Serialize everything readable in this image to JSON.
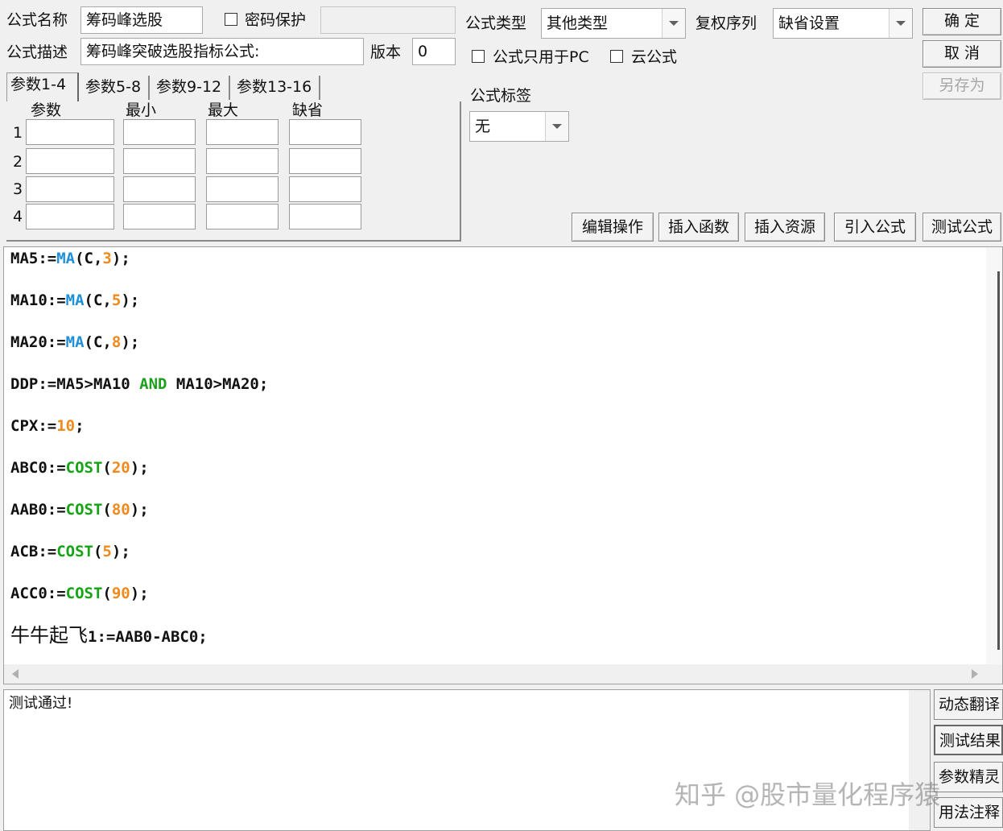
{
  "header": {
    "name_label": "公式名称",
    "name_value": "筹码峰选股",
    "password_label": "密码保护",
    "password_checked": false,
    "desc_label": "公式描述",
    "desc_value": "筹码峰突破选股指标公式:",
    "version_label": "版本",
    "version_value": "0",
    "type_label": "公式类型",
    "type_value": "其他类型",
    "rights_label": "复权序列",
    "rights_value": "缺省设置",
    "pc_only_label": "公式只用于PC",
    "pc_only_checked": false,
    "cloud_label": "云公式",
    "cloud_checked": false,
    "tag_label": "公式标签",
    "tag_value": "无"
  },
  "buttons": {
    "ok": "确 定",
    "cancel": "取 消",
    "save_as": "另存为",
    "edit_ops": "编辑操作",
    "insert_func": "插入函数",
    "insert_res": "插入资源",
    "import_formula": "引入公式",
    "test_formula": "测试公式"
  },
  "params": {
    "tabs": [
      "参数1-4",
      "参数5-8",
      "参数9-12",
      "参数13-16"
    ],
    "active_tab": 0,
    "columns": [
      "参数",
      "最小",
      "最大",
      "缺省"
    ],
    "rows": [
      "1",
      "2",
      "3",
      "4"
    ]
  },
  "code": [
    [
      {
        "t": "MA5:=",
        "c": "var"
      },
      {
        "t": "MA",
        "c": "fn-blue"
      },
      {
        "t": "(C,",
        "c": "var"
      },
      {
        "t": "3",
        "c": "num"
      },
      {
        "t": ");",
        "c": "var"
      }
    ],
    [
      {
        "t": "MA10:=",
        "c": "var"
      },
      {
        "t": "MA",
        "c": "fn-blue"
      },
      {
        "t": "(C,",
        "c": "var"
      },
      {
        "t": "5",
        "c": "num"
      },
      {
        "t": ");",
        "c": "var"
      }
    ],
    [
      {
        "t": "MA20:=",
        "c": "var"
      },
      {
        "t": "MA",
        "c": "fn-blue"
      },
      {
        "t": "(C,",
        "c": "var"
      },
      {
        "t": "8",
        "c": "num"
      },
      {
        "t": ");",
        "c": "var"
      }
    ],
    [
      {
        "t": "DDP:=MA5>MA10 ",
        "c": "var"
      },
      {
        "t": "AND",
        "c": "kw"
      },
      {
        "t": " MA10>MA20;",
        "c": "var"
      }
    ],
    [
      {
        "t": "CPX:=",
        "c": "var"
      },
      {
        "t": "10",
        "c": "num"
      },
      {
        "t": ";",
        "c": "var"
      }
    ],
    [
      {
        "t": "ABC0:=",
        "c": "var"
      },
      {
        "t": "COST",
        "c": "fn-green"
      },
      {
        "t": "(",
        "c": "var"
      },
      {
        "t": "20",
        "c": "num"
      },
      {
        "t": ");",
        "c": "var"
      }
    ],
    [
      {
        "t": "AAB0:=",
        "c": "var"
      },
      {
        "t": "COST",
        "c": "fn-green"
      },
      {
        "t": "(",
        "c": "var"
      },
      {
        "t": "80",
        "c": "num"
      },
      {
        "t": ");",
        "c": "var"
      }
    ],
    [
      {
        "t": "ACB:=",
        "c": "var"
      },
      {
        "t": "COST",
        "c": "fn-green"
      },
      {
        "t": "(",
        "c": "var"
      },
      {
        "t": "5",
        "c": "num"
      },
      {
        "t": ");",
        "c": "var"
      }
    ],
    [
      {
        "t": "ACC0:=",
        "c": "var"
      },
      {
        "t": "COST",
        "c": "fn-green"
      },
      {
        "t": "(",
        "c": "var"
      },
      {
        "t": "90",
        "c": "num"
      },
      {
        "t": ");",
        "c": "var"
      }
    ],
    [
      {
        "t": "牛牛起飞",
        "c": "cn"
      },
      {
        "t": "1:=AAB0-ABC0;",
        "c": "var"
      }
    ]
  ],
  "output": {
    "message": "测试通过!"
  },
  "side_buttons": [
    "动态翻译",
    "测试结果",
    "参数精灵",
    "用法注释"
  ],
  "watermark": "知乎 @股市量化程序猿"
}
